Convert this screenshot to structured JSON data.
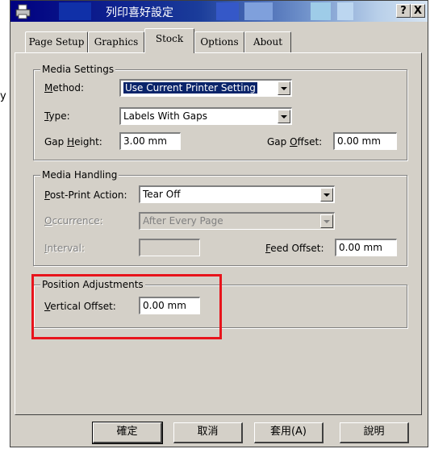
{
  "window": {
    "title": "列印喜好設定",
    "help_label": "?",
    "close_label": "X"
  },
  "left_fragment": "y",
  "tabs": [
    {
      "label": "Page Setup",
      "active": false
    },
    {
      "label": "Graphics",
      "active": false
    },
    {
      "label": "Stock",
      "active": true
    },
    {
      "label": "Options",
      "active": false
    },
    {
      "label": "About",
      "active": false
    }
  ],
  "media_settings": {
    "legend": "Media Settings",
    "method_label": "Method:",
    "method_value": "Use Current Printer Setting",
    "type_label": "Type:",
    "type_value": "Labels With Gaps",
    "gap_height_label": "Gap Height:",
    "gap_height_value": "3.00 mm",
    "gap_offset_label": "Gap Offset:",
    "gap_offset_value": "0.00 mm"
  },
  "media_handling": {
    "legend": "Media Handling",
    "post_print_label": "Post-Print Action:",
    "post_print_value": "Tear Off",
    "occurrence_label": "Occurrence:",
    "occurrence_value": "After Every Page",
    "interval_label": "Interval:",
    "interval_value": "",
    "feed_offset_label": "Feed Offset:",
    "feed_offset_value": "0.00 mm"
  },
  "position_adjustments": {
    "legend": "Position Adjustments",
    "vertical_offset_label": "Vertical Offset:",
    "vertical_offset_value": "0.00 mm"
  },
  "buttons": {
    "ok": "確定",
    "cancel": "取消",
    "apply": "套用(A)",
    "help": "說明"
  },
  "colors": {
    "highlight": "#e8141c",
    "titlebar": "#000080",
    "selection": "#0a246a"
  }
}
